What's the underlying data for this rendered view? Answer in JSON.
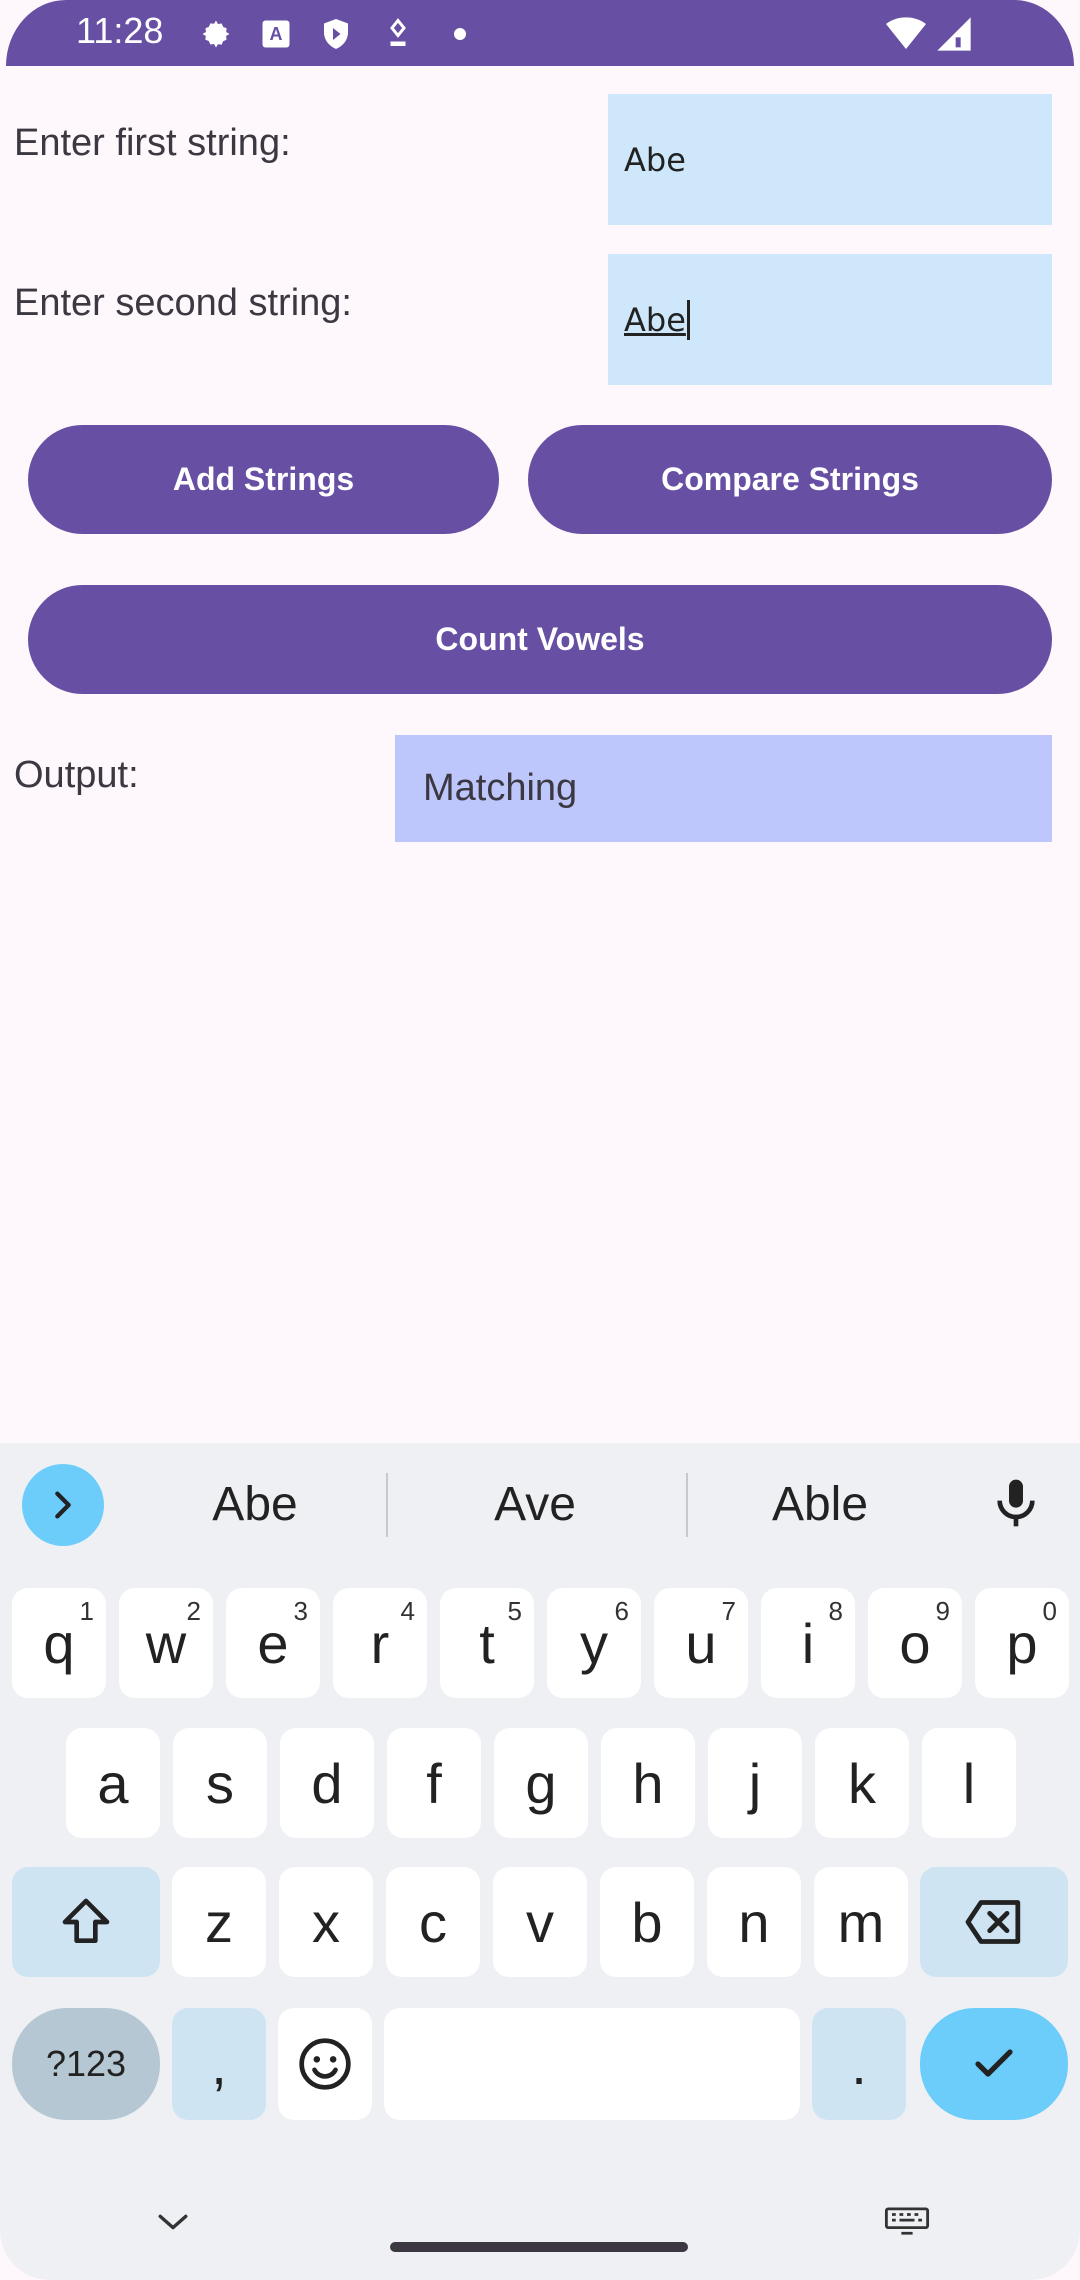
{
  "status_bar": {
    "time": "11:28",
    "icons": [
      "settings-icon",
      "font-icon",
      "shield-icon",
      "location-pin-icon",
      "dot-icon",
      "wifi-icon",
      "signal-icon"
    ]
  },
  "form": {
    "first_label": "Enter first string:",
    "first_value": "Abe",
    "second_label": "Enter second string:",
    "second_value": "Abe"
  },
  "buttons": {
    "add": "Add Strings",
    "compare": "Compare Strings",
    "count": "Count Vowels"
  },
  "output": {
    "label": "Output:",
    "value": "Matching"
  },
  "keyboard": {
    "suggestions": [
      "Abe",
      "Ave",
      "Able"
    ],
    "row1": [
      {
        "key": "q",
        "sup": "1"
      },
      {
        "key": "w",
        "sup": "2"
      },
      {
        "key": "e",
        "sup": "3"
      },
      {
        "key": "r",
        "sup": "4"
      },
      {
        "key": "t",
        "sup": "5"
      },
      {
        "key": "y",
        "sup": "6"
      },
      {
        "key": "u",
        "sup": "7"
      },
      {
        "key": "i",
        "sup": "8"
      },
      {
        "key": "o",
        "sup": "9"
      },
      {
        "key": "p",
        "sup": "0"
      }
    ],
    "row2": [
      "a",
      "s",
      "d",
      "f",
      "g",
      "h",
      "j",
      "k",
      "l"
    ],
    "row3": [
      "z",
      "x",
      "c",
      "v",
      "b",
      "n",
      "m"
    ],
    "symbols_label": "?123",
    "comma": ",",
    "period": "."
  },
  "colors": {
    "primary": "#6750a4",
    "field_bg": "#cfe7fa",
    "output_bg": "#bec7fb",
    "keyboard_accent": "#6ccdfa"
  }
}
